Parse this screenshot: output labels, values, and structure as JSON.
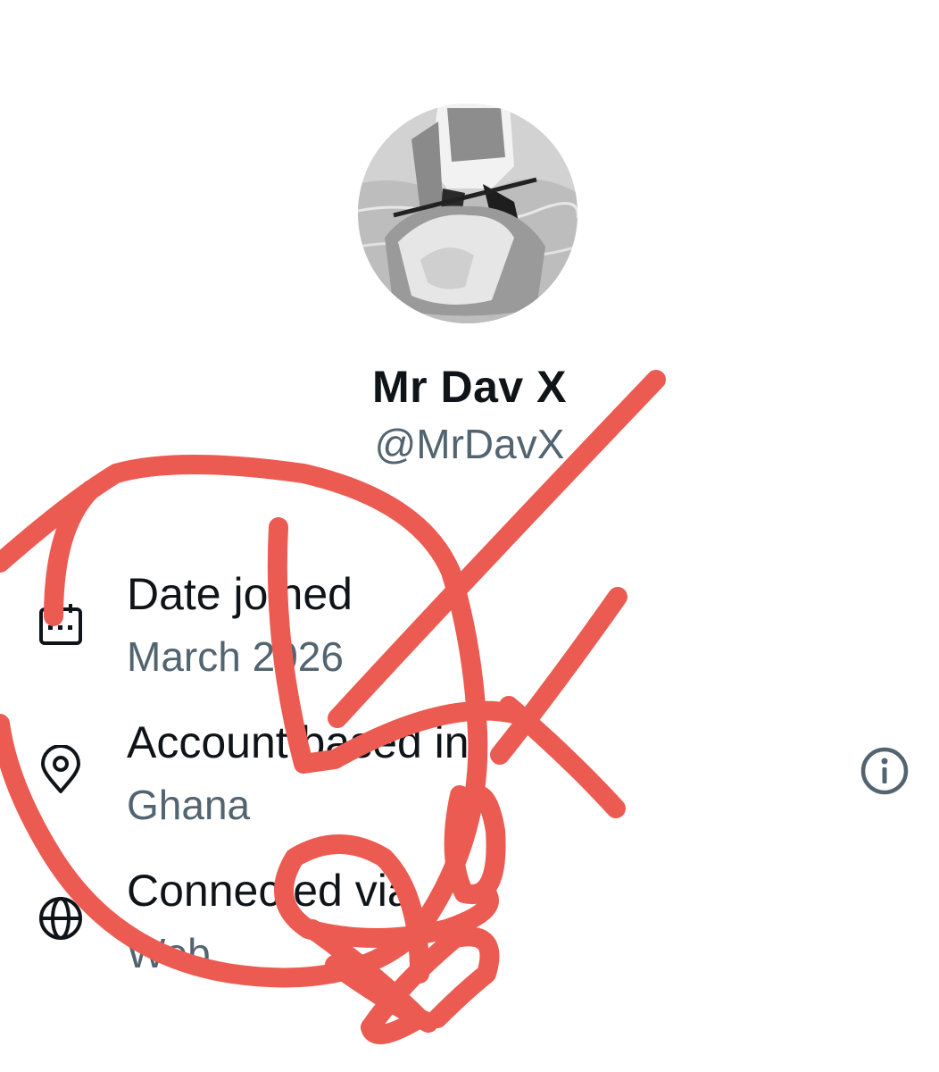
{
  "profile": {
    "display_name": "Mr Dav X",
    "handle": "@MrDavX",
    "avatar_icon": "profile-photo-jetski"
  },
  "details": [
    {
      "icon": "calendar-icon",
      "label": "Date joined",
      "value": "March 2026"
    },
    {
      "icon": "location-pin-icon",
      "label": "Account based in",
      "value": "Ghana"
    },
    {
      "icon": "globe-icon",
      "label": "Connected via",
      "value": "Web"
    }
  ],
  "info_button": {
    "icon": "info-circle-icon"
  },
  "colors": {
    "primary_text": "#0f1419",
    "secondary_text": "#536471",
    "annotation_red": "#ec5b52"
  }
}
